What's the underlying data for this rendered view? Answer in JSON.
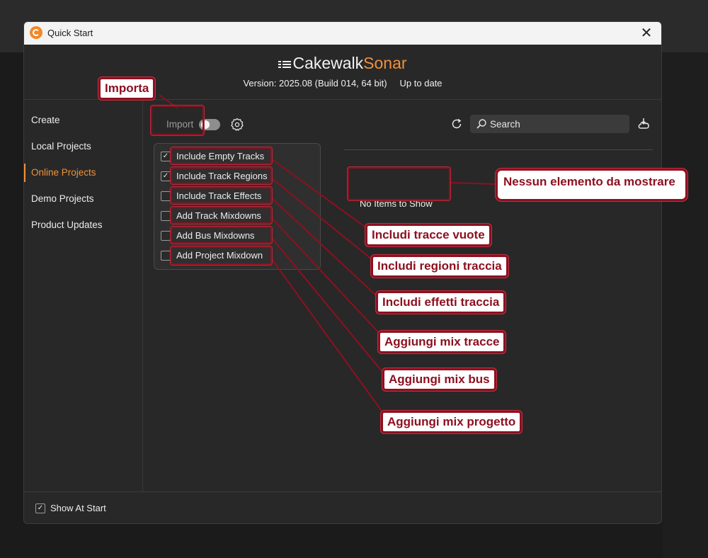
{
  "window": {
    "title": "Quick Start",
    "close_symbol": "✕",
    "logo_part1": "Cakewalk",
    "logo_part2": "Sonar",
    "version": "Version: 2025.08 (Build 014, 64 bit)",
    "update_status": "Up to date",
    "accent_color": "#f0913a"
  },
  "sidebar": {
    "items": [
      {
        "label": "Create"
      },
      {
        "label": "Local Projects"
      },
      {
        "label": "Online Projects",
        "active": true
      },
      {
        "label": "Demo Projects"
      },
      {
        "label": "Product Updates"
      }
    ]
  },
  "toolbar": {
    "import_label": "Import",
    "search_placeholder": "Search"
  },
  "import_options": [
    {
      "label": "Include Empty Tracks",
      "checked": true
    },
    {
      "label": "Include Track Regions",
      "checked": true
    },
    {
      "label": "Include Track Effects",
      "checked": false
    },
    {
      "label": "Add Track Mixdowns",
      "checked": false
    },
    {
      "label": "Add Bus Mixdowns",
      "checked": false
    },
    {
      "label": "Add Project Mixdown",
      "checked": false
    }
  ],
  "main": {
    "empty_message": "No Items to Show"
  },
  "footer": {
    "show_at_start_label": "Show At Start",
    "show_at_start_checked": true
  },
  "annotations": {
    "importa": "Importa",
    "nessun_elemento": "Nessun elemento da mostrare",
    "includi_tracce_vuote": "Includi tracce vuote",
    "includi_regioni_traccia": "Includi regioni traccia",
    "includi_effetti_traccia": "Includi effetti traccia",
    "aggiungi_mix_tracce": "Aggiungi mix tracce",
    "aggiungi_mix_bus": "Aggiungi mix bus",
    "aggiungi_mix_progetto": "Aggiungi mix progetto"
  },
  "check_mark": "✓"
}
